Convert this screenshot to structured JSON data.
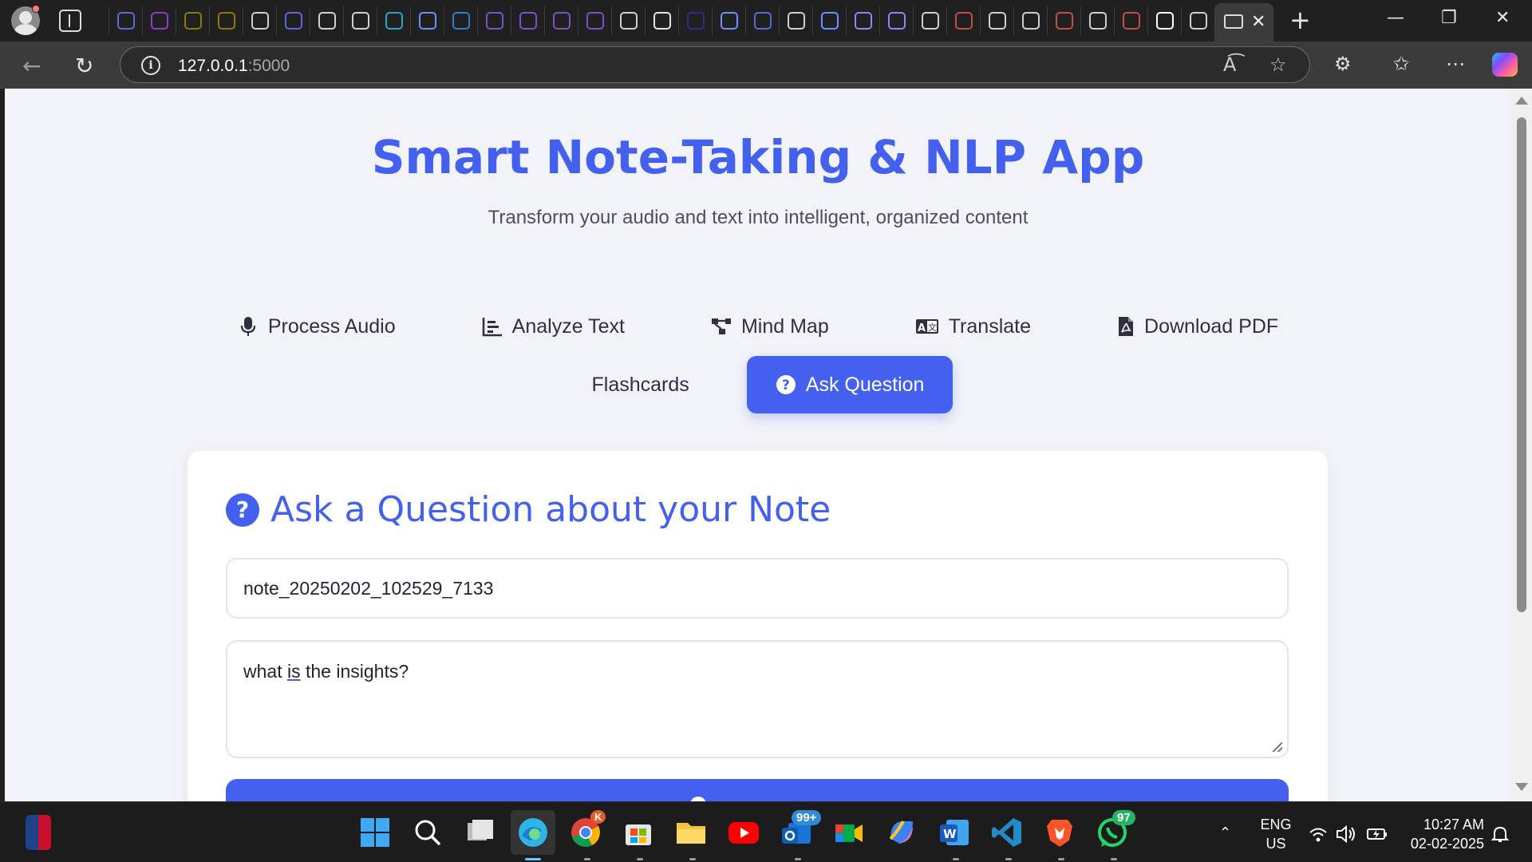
{
  "browser": {
    "url_host": "127.0.0.1",
    "url_port": ":5000",
    "tab_favicon_colors": [
      "#5b6bd6",
      "#8a3fd1",
      "#8a7a00",
      "#8a7a00",
      "#cfcfcf",
      "#5b6bd6",
      "#cfcfcf",
      "#cfcfcf",
      "#2aa4c7",
      "#6d8fff",
      "#2d7fd2",
      "#7b51c9",
      "#7b51c9",
      "#7b51c9",
      "#7b51c9",
      "#cfcfcf",
      "#e6e6e6",
      "#2a2a8f",
      "#6d8fff",
      "#5b6bd6",
      "#cfcfcf",
      "#6d8fff",
      "#8a86ff",
      "#8a86ff",
      "#cfcfcf",
      "#c94a4a",
      "#cfcfcf",
      "#cfcfcf",
      "#c94a4a",
      "#cfcfcf",
      "#c94a4a",
      "#ffffff",
      "#cfcfcf"
    ]
  },
  "app": {
    "title": "Smart Note-Taking & NLP App",
    "subtitle": "Transform your audio and text into intelligent, organized content",
    "accent_color": "#4361ee",
    "tabs": [
      {
        "label": "Process Audio",
        "icon": "microphone-icon"
      },
      {
        "label": "Analyze Text",
        "icon": "chart-bar-icon"
      },
      {
        "label": "Mind Map",
        "icon": "sitemap-icon"
      },
      {
        "label": "Translate",
        "icon": "language-icon"
      },
      {
        "label": "Download PDF",
        "icon": "file-pdf-icon"
      }
    ],
    "tabs_row2": [
      {
        "label": "Flashcards",
        "icon": ""
      },
      {
        "label": "Ask Question",
        "icon": "question-circle-icon",
        "active": true
      }
    ]
  },
  "ask_card": {
    "title": "Ask a Question about your Note",
    "title_icon": "?",
    "note_id_value": "note_20250202_102529_7133",
    "question_prefix": "what ",
    "question_underlined": "is",
    "question_suffix": " the insights?"
  },
  "taskbar": {
    "badge_mail": "99+",
    "badge_whatsapp": "97",
    "badge_chrome": "K",
    "language_line1": "ENG",
    "language_line2": "US",
    "time": "10:27 AM",
    "date": "02-02-2025"
  }
}
